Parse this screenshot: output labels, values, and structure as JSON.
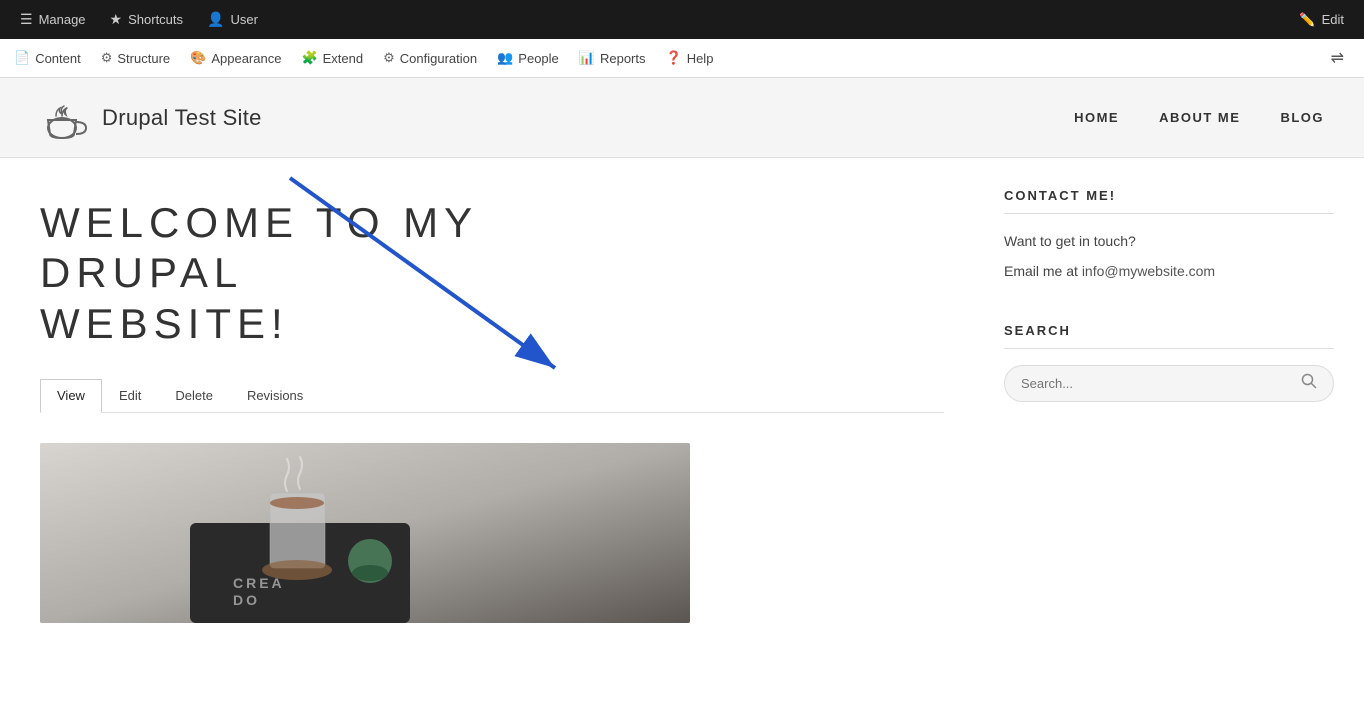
{
  "admin_toolbar": {
    "manage_label": "Manage",
    "shortcuts_label": "Shortcuts",
    "user_label": "User",
    "edit_label": "Edit"
  },
  "menu_bar": {
    "items": [
      {
        "id": "content",
        "label": "Content",
        "icon": "📄"
      },
      {
        "id": "structure",
        "label": "Structure",
        "icon": "🔧"
      },
      {
        "id": "appearance",
        "label": "Appearance",
        "icon": "🎨"
      },
      {
        "id": "extend",
        "label": "Extend",
        "icon": "🧩"
      },
      {
        "id": "configuration",
        "label": "Configuration",
        "icon": "⚙️"
      },
      {
        "id": "people",
        "label": "People",
        "icon": "👤"
      },
      {
        "id": "reports",
        "label": "Reports",
        "icon": "📊"
      },
      {
        "id": "help",
        "label": "Help",
        "icon": "❓"
      }
    ]
  },
  "site": {
    "title": "Drupal Test Site",
    "nav": [
      {
        "id": "home",
        "label": "HOME"
      },
      {
        "id": "about",
        "label": "ABOUT ME"
      },
      {
        "id": "blog",
        "label": "BLOG"
      }
    ]
  },
  "page": {
    "heading_line1": "WELCOME TO MY DRUPAL",
    "heading_line2": "WEBSITE!",
    "tabs": [
      {
        "id": "view",
        "label": "View",
        "active": true
      },
      {
        "id": "edit",
        "label": "Edit",
        "active": false
      },
      {
        "id": "delete",
        "label": "Delete",
        "active": false
      },
      {
        "id": "revisions",
        "label": "Revisions",
        "active": false
      }
    ]
  },
  "sidebar": {
    "contact_title": "CONTACT ME!",
    "contact_text": "Want to get in touch?",
    "contact_email_prefix": "Email me at ",
    "contact_email": "info@mywebsite.com",
    "search_title": "SEARCH",
    "search_placeholder": "Search..."
  },
  "image_overlay_text": "CREA\nDO"
}
